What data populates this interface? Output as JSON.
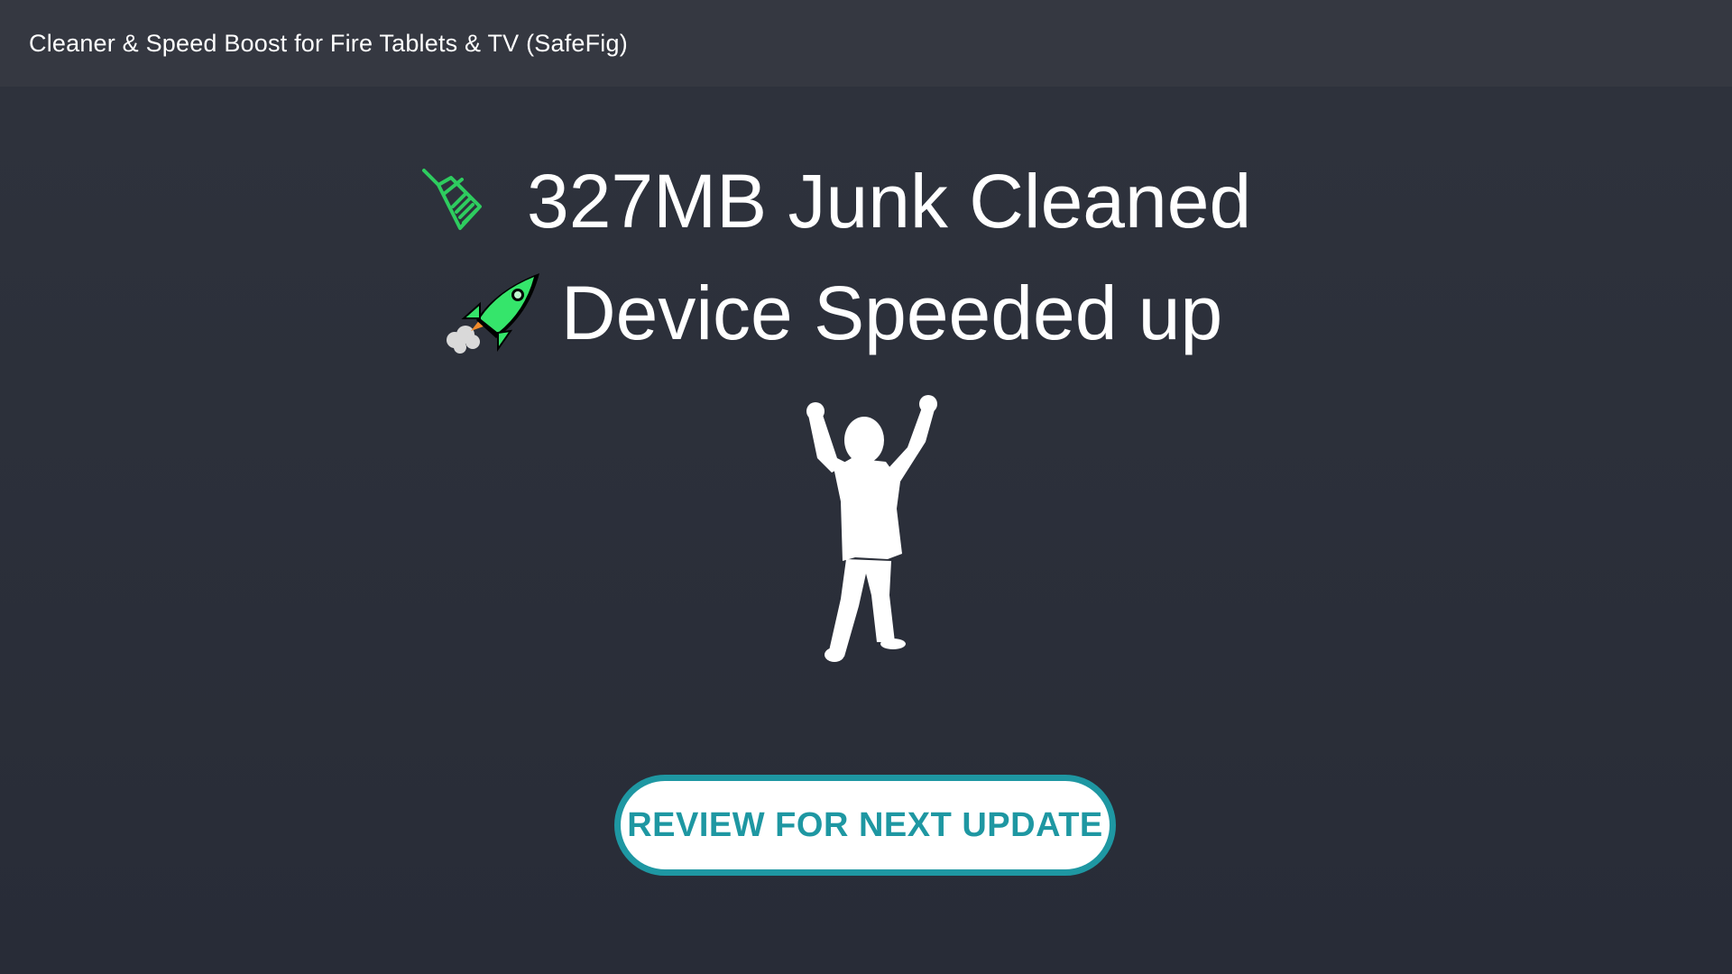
{
  "app_bar": {
    "title": "Cleaner & Speed Boost for Fire Tablets & TV (SafeFig)"
  },
  "results": {
    "junk": {
      "icon": "broom-icon",
      "text": "327MB Junk Cleaned"
    },
    "speed": {
      "icon": "rocket-icon",
      "text": "Device Speeded up"
    },
    "illustration": "celebrating-person-icon"
  },
  "review_button": {
    "label": "REVIEW FOR NEXT UPDATE"
  },
  "colors": {
    "background": "#2b2f3a",
    "app_bar": "#353841",
    "accent_green": "#2ecc5f",
    "button_teal": "#1e97a2",
    "text": "#ffffff"
  }
}
